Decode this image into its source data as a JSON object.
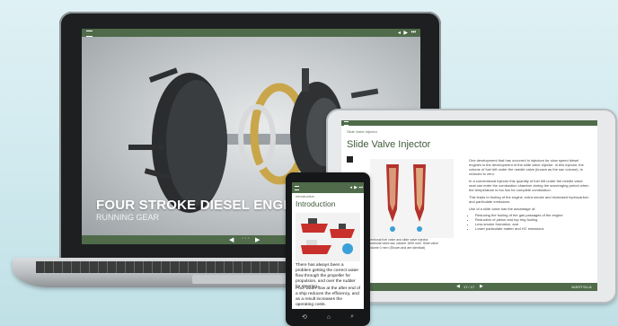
{
  "laptop": {
    "hero_title": "FOUR STROKE DIESEL ENGINES",
    "hero_subtitle": "RUNNING GEAR"
  },
  "tablet": {
    "breadcrumb": "Slide Valve Injector",
    "title": "Slide Valve Injector",
    "paragraphs": [
      "One development that has occurred in injectors for slow speed diesel engines is the development of the slide valve injector. In this injector, the volume of fuel left under the needle valve (known as the sac volume), is reduced to zero.",
      "In a conventional injector this quantity of fuel left under the needle valve seat can enter the combustion chamber during the scavenging period when the temperature is too low for complete combustion.",
      "This leads to fouling of the engine, extra smoke and increased hydrocarbon and particulate emissions.",
      "Use of a slide valve has the advantage of:"
    ],
    "bullets": [
      "Reducing the fouling of the gas passages of the engine",
      "Reduction of piston and top ring fouling",
      "Less smoke formation, and",
      "Lower particulate matter and HC emissions"
    ],
    "caption": "Conventional fuel valve and slide valve injector. Conventional valve sac volume 1690 mm³. Slide valve sac volume 0 mm³ (Shown and are identical)",
    "pager": "17 / 17",
    "brand": "WÄRTSILÄ"
  },
  "phone": {
    "section": "Introduction",
    "title": "Introduction",
    "paragraphs": [
      "There has always been a problem getting the correct water flow through the propeller for propulsion, and over the rudder for steering.",
      "Poor water flow at the after end of a ship reduces the efficiency, and as a result increases the operating costs."
    ],
    "nav_back": "⟲",
    "nav_home": "⌂",
    "nav_search": "⌕"
  },
  "colors": {
    "brand_green": "#4f6b4a",
    "title_green": "#3f5a3a"
  }
}
